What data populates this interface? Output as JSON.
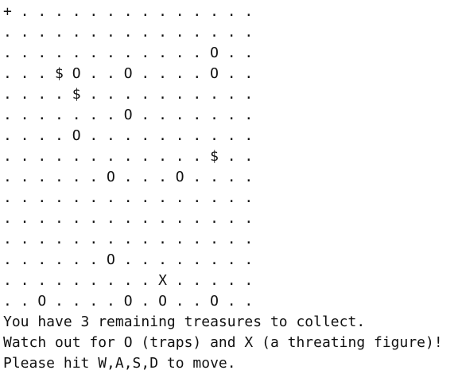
{
  "board": {
    "rows": [
      "+ . . . . . . . . . . . . . .",
      ". . . . . . . . . . . . . . .",
      ". . . . . . . . . . . . O . .",
      ". . . $ O . . O . . . . O . .",
      ". . . . $ . . . . . . . . . .",
      ". . . . . . . O . . . . . . .",
      ". . . . O . . . . . . . . . .",
      ". . . . . . . . . . . . $ . .",
      ". . . . . . O . . . O . . . .",
      ". . . . . . . . . . . . . . .",
      ". . . . . . . . . . . . . . .",
      ". . . . . . . . . . . . . . .",
      ". . . . . . O . . . . . . . .",
      ". . . . . . . . . X . . . . .",
      ". . O . . . . O . O . . O . ."
    ]
  },
  "messages": {
    "line1": "You have 3 remaining treasures to collect.",
    "line2": "Watch out for O (traps) and X (a threating figure)!",
    "line3": "Please hit W,A,S,D to move."
  }
}
